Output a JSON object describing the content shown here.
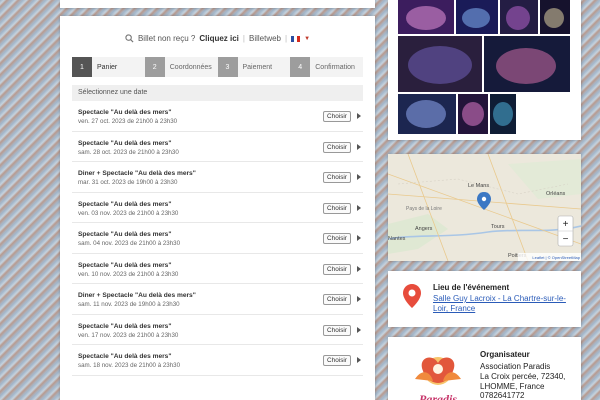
{
  "help": {
    "prefix": "Billet non reçu ?",
    "link": "Cliquez ici",
    "sep": "|",
    "brand": "Billetweb",
    "sep2": "|"
  },
  "steps": [
    {
      "num": "1",
      "label": "Panier",
      "active": true
    },
    {
      "num": "2",
      "label": "Coordonnées"
    },
    {
      "num": "3",
      "label": "Paiement"
    },
    {
      "num": "4",
      "label": "Confirmation"
    }
  ],
  "dates_heading": "Sélectionnez une date",
  "choose_label": "Choisir",
  "sessions": [
    {
      "title": "Spectacle \"Au delà des mers\"",
      "date": "ven. 27 oct. 2023 de 21h00 à 23h30"
    },
    {
      "title": "Spectacle \"Au delà des mers\"",
      "date": "sam. 28 oct. 2023 de 21h00 à 23h30"
    },
    {
      "title": "Diner + Spectacle \"Au delà des mers\"",
      "date": "mar. 31 oct. 2023 de 19h00 à 23h30"
    },
    {
      "title": "Spectacle \"Au delà des mers\"",
      "date": "ven. 03 nov. 2023 de 21h00 à 23h30"
    },
    {
      "title": "Spectacle \"Au delà des mers\"",
      "date": "sam. 04 nov. 2023 de 21h00 à 23h30"
    },
    {
      "title": "Spectacle \"Au delà des mers\"",
      "date": "ven. 10 nov. 2023 de 21h00 à 23h30"
    },
    {
      "title": "Diner + Spectacle \"Au delà des mers\"",
      "date": "sam. 11 nov. 2023 de 19h00 à 23h30"
    },
    {
      "title": "Spectacle \"Au delà des mers\"",
      "date": "ven. 17 nov. 2023 de 21h00 à 23h30"
    },
    {
      "title": "Spectacle \"Au delà des mers\"",
      "date": "sam. 18 nov. 2023 de 21h00 à 23h30"
    }
  ],
  "map": {
    "labels": [
      "Le Mans",
      "Orléans",
      "Pays de la Loire",
      "Angers",
      "Tours",
      "Nantes",
      "Poitiers"
    ],
    "zoom_in": "+",
    "zoom_out": "−",
    "attribution": "Leaflet | © OpenStreetMap"
  },
  "location": {
    "heading": "Lieu de l'événement",
    "address": "Salle Guy Lacroix - La Chartre-sur-le-Loir, France"
  },
  "organizer": {
    "heading": "Organisateur",
    "name": "Association Paradis",
    "street": "La Croix percée, 72340,",
    "city": "LHOMME, France",
    "phone": "0782641772",
    "logo_text": "Paradis"
  },
  "colors": {
    "link": "#2a5bb8",
    "accent": "#e74c3c",
    "marker": "#3b78c4"
  }
}
